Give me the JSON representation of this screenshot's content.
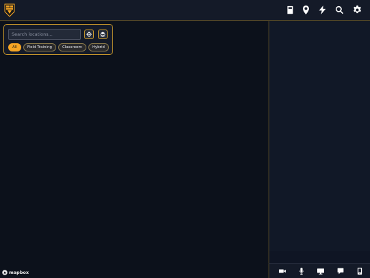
{
  "header": {
    "icons": [
      "book-icon",
      "location-pin-icon",
      "lightning-icon",
      "search-icon",
      "gear-icon"
    ]
  },
  "search": {
    "placeholder": "Search locations...",
    "buttons": [
      "crosshair-icon",
      "layers-icon"
    ]
  },
  "filters": {
    "chips": [
      {
        "label": "All",
        "active": true
      },
      {
        "label": "Field Training",
        "active": false
      },
      {
        "label": "Classroom",
        "active": false
      },
      {
        "label": "Hybrid",
        "active": false
      }
    ]
  },
  "toolbar": {
    "icons": [
      "video-camera-icon",
      "microphone-icon",
      "monitor-icon",
      "chat-icon",
      "phone-icon"
    ]
  },
  "attribution": {
    "text": "mapbox"
  },
  "colors": {
    "accent": "#f5a524",
    "border": "#c9982a",
    "background": "#0c111b",
    "panel": "#141a28"
  }
}
